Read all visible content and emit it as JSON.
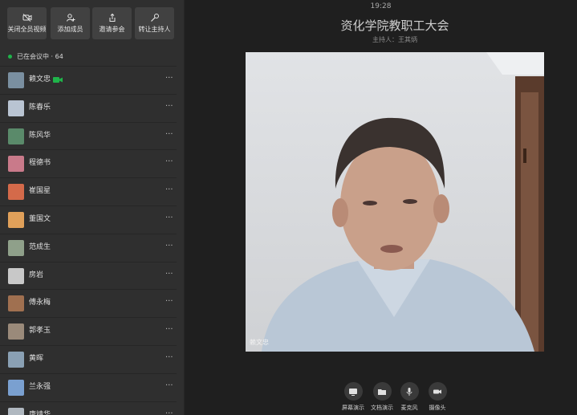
{
  "toolbar": {
    "mute_all_video": "关闭全员视频",
    "add_member": "添加成员",
    "invite": "邀请参会",
    "transfer_host": "转让主持人"
  },
  "status": {
    "label": "已在会议中 · 64"
  },
  "participants": [
    {
      "name": "赖文忠",
      "avatar_color": "#7a8fa0",
      "video_on": true
    },
    {
      "name": "陈春乐",
      "avatar_color": "#b9c4d2"
    },
    {
      "name": "陈风华",
      "avatar_color": "#5a8a6a"
    },
    {
      "name": "程德书",
      "avatar_color": "#c97a8a"
    },
    {
      "name": "崔国星",
      "avatar_color": "#d46a4a"
    },
    {
      "name": "董国文",
      "avatar_color": "#e0a05a"
    },
    {
      "name": "范成生",
      "avatar_color": "#8fa08a"
    },
    {
      "name": "房岩",
      "avatar_color": "#c8c8c8"
    },
    {
      "name": "傅永梅",
      "avatar_color": "#a07050"
    },
    {
      "name": "郭孝玉",
      "avatar_color": "#9a8a7a"
    },
    {
      "name": "黄晖",
      "avatar_color": "#8aa0b4"
    },
    {
      "name": "兰永强",
      "avatar_color": "#7aa0d0"
    },
    {
      "name": "唐靖华",
      "avatar_color": "#b0b8c0"
    }
  ],
  "meeting": {
    "time": "19:28",
    "title": "资化学院教职工大会",
    "host": "主持人：王其炳"
  },
  "video": {
    "speaker_label": "赖文忠"
  },
  "controls": {
    "screen_share": "屏幕演示",
    "doc_share": "文档演示",
    "mic": "麦克风",
    "camera": "摄像头"
  },
  "colors": {
    "sidebar_bg": "#2f2f2f",
    "main_bg": "#1f1f1f",
    "status_green": "#1fb44a",
    "camera_on_green": "#1fb44a"
  }
}
